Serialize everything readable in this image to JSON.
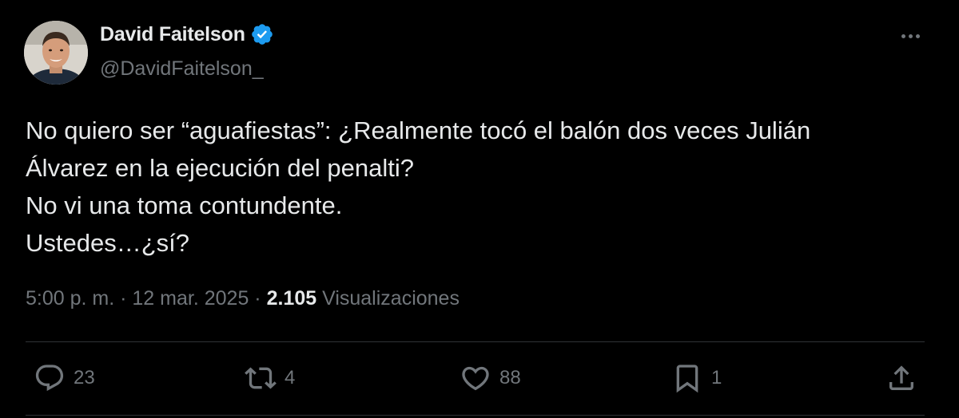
{
  "author": {
    "display_name": "David Faitelson",
    "handle": "@DavidFaitelson_",
    "verified": true,
    "verified_color": "#1d9bf0"
  },
  "tweet": {
    "lines": [
      "No quiero ser “aguafiestas”: ¿Realmente tocó el balón dos veces Julián",
      "Álvarez en la ejecución del penalti?",
      "No vi una toma contundente.",
      "Ustedes…¿sí?"
    ]
  },
  "meta": {
    "time": "5:00 p. m.",
    "separator": "·",
    "date": "12 mar. 2025",
    "views_count": "2.105",
    "views_label": "Visualizaciones"
  },
  "actions": {
    "replies": "23",
    "retweets": "4",
    "likes": "88",
    "bookmarks": "1"
  },
  "icons": {
    "more": "more-horizontal-icon",
    "reply": "reply-bubble-icon",
    "retweet": "retweet-icon",
    "like": "heart-icon",
    "bookmark": "bookmark-icon",
    "share": "share-upload-icon"
  },
  "colors": {
    "background": "#000000",
    "primary_text": "#e7e9ea",
    "secondary_text": "#71767b",
    "divider": "#2f3336"
  }
}
